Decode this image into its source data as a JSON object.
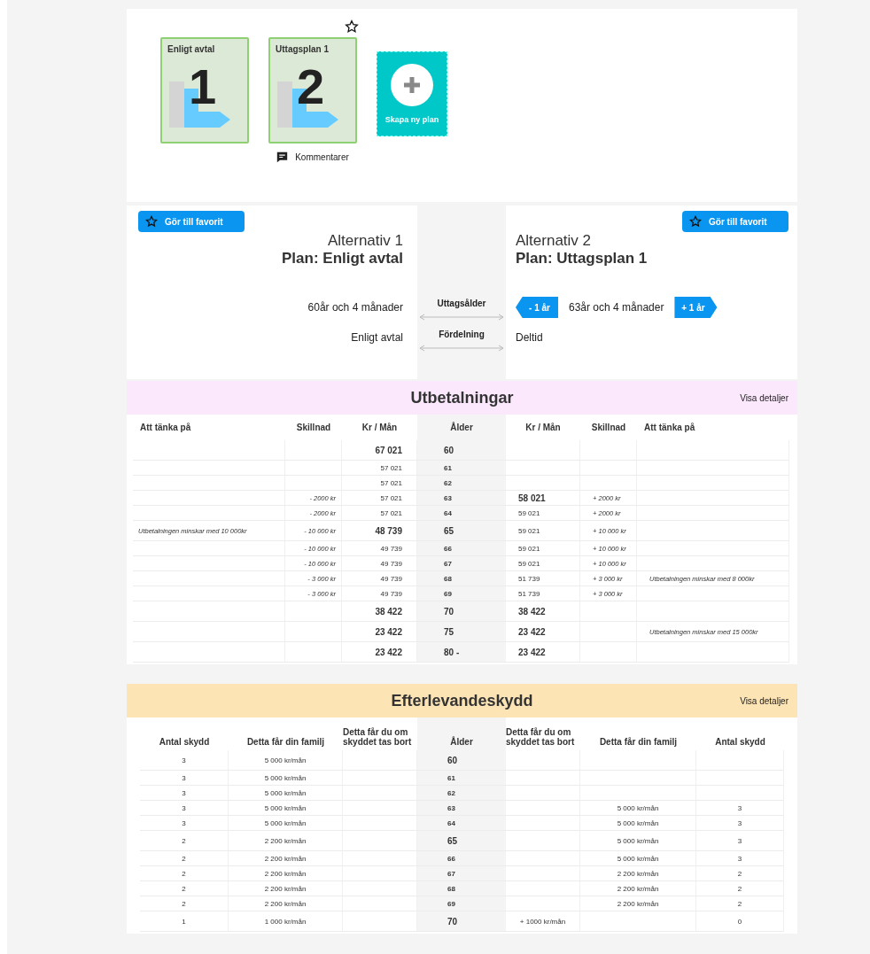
{
  "plans": [
    {
      "title": "Enligt avtal",
      "number": "1",
      "favorite": false
    },
    {
      "title": "Uttagsplan 1",
      "number": "2",
      "favorite": true,
      "comments": "Kommentarer"
    }
  ],
  "create_plan": "Skapa ny plan",
  "comparison": {
    "left": {
      "favorite_button": "Gör till favorit",
      "alternative": "Alternativ 1",
      "plan": "Plan: Enligt avtal",
      "age": "60år och 4 månader",
      "distribution": "Enligt avtal"
    },
    "middle": {
      "age_label": "Uttagsålder",
      "distribution_label": "Fördelning"
    },
    "right": {
      "favorite_button": "Gör till favorit",
      "alternative": "Alternativ 2",
      "plan": "Plan: Uttagsplan 1",
      "age": "63år och 4 månader",
      "distribution": "Deltid",
      "decrease_button": "- 1 år",
      "increase_button": "+ 1 år"
    }
  },
  "payouts": {
    "title": "Utbetalningar",
    "details_link": "Visa detaljer",
    "columns": [
      "Att tänka på",
      "Skillnad",
      "Kr / Mån",
      "Ålder",
      "Kr / Mån",
      "Skillnad",
      "Att tänka på"
    ],
    "rows": [
      {
        "age": "60",
        "emphasized": true,
        "left": {
          "amount": "67 021",
          "emphasized": true
        },
        "right": {}
      },
      {
        "age": "61",
        "emphasized": false,
        "left": {
          "amount": "57 021",
          "emphasized": false
        },
        "right": {}
      },
      {
        "age": "62",
        "emphasized": false,
        "left": {
          "amount": "57 021",
          "emphasized": false
        },
        "right": {}
      },
      {
        "age": "63",
        "emphasized": false,
        "left": {
          "diff": "- 2000 kr",
          "amount": "57 021",
          "emphasized": false
        },
        "right": {
          "diff": "+ 2000 kr",
          "amount": "58 021",
          "emphasized": true
        }
      },
      {
        "age": "64",
        "emphasized": false,
        "left": {
          "diff": "- 2000 kr",
          "amount": "57 021",
          "emphasized": false
        },
        "right": {
          "diff": "+ 2000 kr",
          "amount": "59 021",
          "emphasized": false
        }
      },
      {
        "age": "65",
        "emphasized": true,
        "left": {
          "note": "Utbetalningen minskar med  10 000kr",
          "diff": "- 10 000 kr",
          "amount": "48 739",
          "emphasized": true
        },
        "right": {
          "diff": "+ 10 000 kr",
          "amount": "59 021",
          "emphasized": false
        }
      },
      {
        "age": "66",
        "emphasized": false,
        "left": {
          "diff": "- 10 000 kr",
          "amount": "49 739",
          "emphasized": false
        },
        "right": {
          "diff": "+ 10 000 kr",
          "amount": "59 021",
          "emphasized": false
        }
      },
      {
        "age": "67",
        "emphasized": false,
        "left": {
          "diff": "- 10 000 kr",
          "amount": "49 739",
          "emphasized": false
        },
        "right": {
          "diff": "+ 10 000 kr",
          "amount": "59 021",
          "emphasized": false
        }
      },
      {
        "age": "68",
        "emphasized": false,
        "left": {
          "diff": "- 3 000 kr",
          "amount": "49 739",
          "emphasized": false
        },
        "right": {
          "note": "Utbetalningen minskar med 8 000kr",
          "diff": "+ 3 000 kr",
          "amount": "51 739",
          "emphasized": false
        }
      },
      {
        "age": "69",
        "emphasized": false,
        "left": {
          "diff": "- 3 000 kr",
          "amount": "49 739",
          "emphasized": false
        },
        "right": {
          "diff": "+ 3 000 kr",
          "amount": "51 739",
          "emphasized": false
        }
      },
      {
        "age": "70",
        "emphasized": true,
        "left": {
          "amount": "38 422",
          "emphasized": true
        },
        "right": {
          "amount": "38 422",
          "emphasized": true
        }
      },
      {
        "age": "75",
        "emphasized": true,
        "left": {
          "amount": "23 422",
          "emphasized": true
        },
        "right": {
          "note": "Utbetalningen minskar med 15 000kr",
          "amount": "23 422",
          "emphasized": true
        }
      },
      {
        "age": "80 -",
        "emphasized": true,
        "left": {
          "amount": "23 422",
          "emphasized": true
        },
        "right": {
          "amount": "23 422",
          "emphasized": true
        }
      }
    ]
  },
  "survivor": {
    "title": "Efterlevandeskydd",
    "details_link": "Visa detaljer",
    "columns": [
      "Antal skydd",
      "Detta får din familj",
      "Detta får du om skyddet tas bort",
      "Ålder",
      "Detta får du om skyddet tas bort",
      "Detta får din familj",
      "Antal skydd"
    ],
    "rows": [
      {
        "age": "60",
        "emphasized": true,
        "left": {
          "count": "3",
          "family": "5 000 kr/mån"
        },
        "right": {}
      },
      {
        "age": "61",
        "emphasized": false,
        "left": {
          "count": "3",
          "family": "5 000 kr/mån"
        },
        "right": {}
      },
      {
        "age": "62",
        "emphasized": false,
        "left": {
          "count": "3",
          "family": "5 000 kr/mån"
        },
        "right": {}
      },
      {
        "age": "63",
        "emphasized": false,
        "left": {
          "count": "3",
          "family": "5 000 kr/mån"
        },
        "right": {
          "count": "3",
          "family": "5 000 kr/mån"
        }
      },
      {
        "age": "64",
        "emphasized": false,
        "left": {
          "count": "3",
          "family": "5 000 kr/mån"
        },
        "right": {
          "count": "3",
          "family": "5 000 kr/mån"
        }
      },
      {
        "age": "65",
        "emphasized": true,
        "left": {
          "count": "2",
          "family": "2 200 kr/mån"
        },
        "right": {
          "count": "3",
          "family": "5 000 kr/mån"
        }
      },
      {
        "age": "66",
        "emphasized": false,
        "left": {
          "count": "2",
          "family": "2 200 kr/mån"
        },
        "right": {
          "count": "3",
          "family": "5 000 kr/mån"
        }
      },
      {
        "age": "67",
        "emphasized": false,
        "left": {
          "count": "2",
          "family": "2 200 kr/mån"
        },
        "right": {
          "count": "2",
          "family": "2 200 kr/mån"
        }
      },
      {
        "age": "68",
        "emphasized": false,
        "left": {
          "count": "2",
          "family": "2 200 kr/mån"
        },
        "right": {
          "count": "2",
          "family": "2 200 kr/mån"
        }
      },
      {
        "age": "69",
        "emphasized": false,
        "left": {
          "count": "2",
          "family": "2 200 kr/mån"
        },
        "right": {
          "count": "2",
          "family": "2 200 kr/mån"
        }
      },
      {
        "age": "70",
        "emphasized": true,
        "left": {
          "count": "1",
          "family": "1 000 kr/mån"
        },
        "right": {
          "count": "0",
          "removed": "+ 1000 kr/mån"
        }
      }
    ]
  }
}
